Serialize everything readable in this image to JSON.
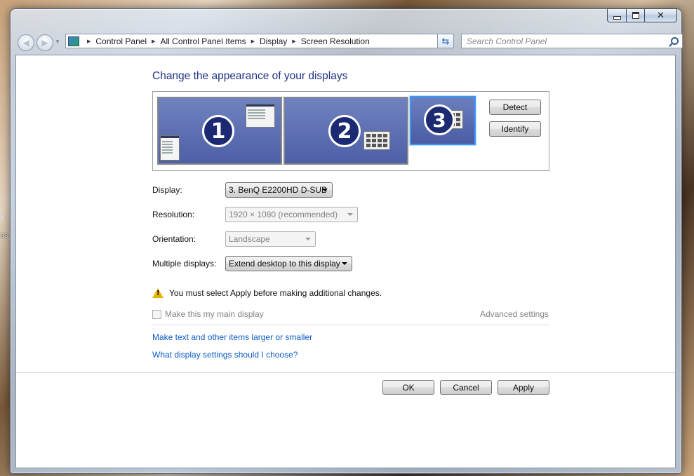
{
  "desktop": {
    "fragment_text": "ns"
  },
  "window": {
    "caption": {
      "minimize": "minimize-icon",
      "maximize": "maximize-icon",
      "close": "close-icon"
    }
  },
  "nav": {
    "breadcrumbs": [
      "Control Panel",
      "All Control Panel Items",
      "Display",
      "Screen Resolution"
    ],
    "search_placeholder": "Search Control Panel"
  },
  "main": {
    "title": "Change the appearance of your displays",
    "monitors": [
      {
        "number": "1"
      },
      {
        "number": "2"
      },
      {
        "number": "3",
        "selected": true
      }
    ],
    "detect_label": "Detect",
    "identify_label": "Identify",
    "fields": {
      "display": {
        "label": "Display:",
        "value": "3. BenQ E2200HD D-SUB"
      },
      "resolution": {
        "label": "Resolution:",
        "value": "1920 × 1080 (recommended)",
        "disabled": true
      },
      "orientation": {
        "label": "Orientation:",
        "value": "Landscape",
        "disabled": true
      },
      "multiple": {
        "label": "Multiple displays:",
        "value": "Extend desktop to this display"
      }
    },
    "warning": "You must select Apply before making additional changes.",
    "main_display_checkbox": "Make this my main display",
    "advanced_link": "Advanced settings",
    "links": {
      "text_size": "Make text and other items larger or smaller",
      "help": "What display settings should I choose?"
    }
  },
  "footer": {
    "ok": "OK",
    "cancel": "Cancel",
    "apply": "Apply"
  },
  "colors": {
    "title": "#1e3287",
    "link": "#0b5cc7",
    "selected_monitor_border": "#3d96f5",
    "monitor_fill": "#5868ad"
  }
}
